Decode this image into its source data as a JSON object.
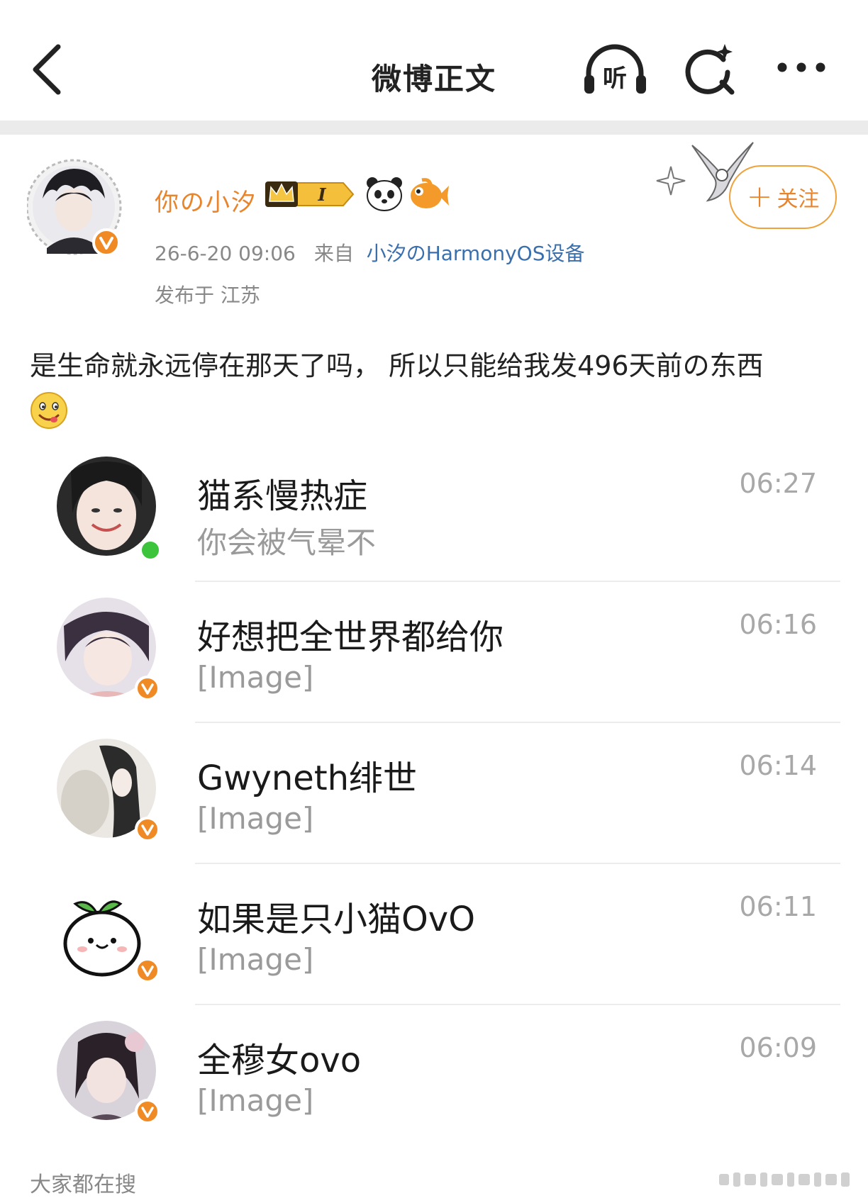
{
  "header": {
    "title": "微博正文",
    "back_icon": "chevron-left-icon",
    "listen_label": "听",
    "search_icon": "ai-search-icon",
    "more_icon": "more-dots-icon"
  },
  "post": {
    "author": {
      "name": "你の小汐",
      "verified_color": "#f08a24",
      "badge_label": "I",
      "name_color": "#e8852c"
    },
    "follow_label": "关注",
    "follow_plus": "+",
    "timestamp": "26-6-20 09:06",
    "source_prefix": "来自",
    "source": "小汐のHarmonyOS设备",
    "location": "发布于 江苏",
    "text": "是生命就永远停在那天了吗， 所以只能给我发496天前の东西",
    "emoji": "drooling-smile-emoji"
  },
  "chats": [
    {
      "name": "猫系慢热症",
      "message": "你会被气晕不",
      "time": "06:27",
      "status": "online"
    },
    {
      "name": "好想把全世界都给你",
      "message": "[Image]",
      "time": "06:16",
      "status": "verified"
    },
    {
      "name": "Gwyneth绯世",
      "message": "[Image]",
      "time": "06:14",
      "status": "verified"
    },
    {
      "name": "如果是只小猫OvO",
      "message": "[Image]",
      "time": "06:11",
      "status": "verified"
    },
    {
      "name": "全穆女ovo",
      "message": "[Image]",
      "time": "06:09",
      "status": "verified"
    }
  ],
  "footer": {
    "search_hint": "大家都在搜"
  },
  "colors": {
    "accent": "#e8852c",
    "link": "#3a6fae",
    "online": "#3cc43c",
    "divider": "#ebebeb"
  }
}
